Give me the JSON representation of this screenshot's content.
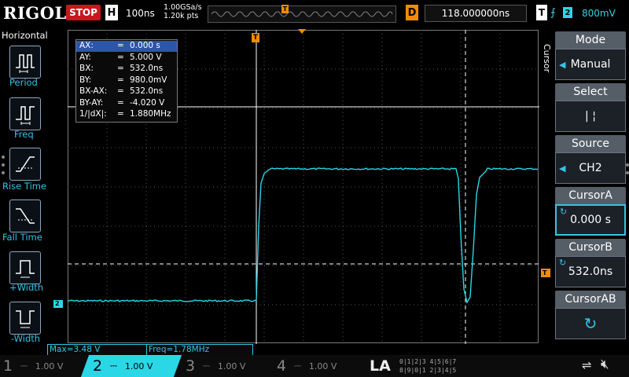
{
  "top": {
    "brand": "RIGOL",
    "run_state": "STOP",
    "horizontal_mode": "H",
    "timebase": "100ns",
    "sample_rate": "1.00GSa/s",
    "points": "1.20k pts",
    "delay_label": "D",
    "delay_value": "118.000000ns",
    "trigger_label": "T",
    "trigger_source": "2",
    "trigger_level": "800mV",
    "trigger_marker": "T"
  },
  "left_panel": {
    "title": "Horizontal",
    "items": [
      {
        "label": "Period",
        "icon": "period-icon"
      },
      {
        "label": "Freq",
        "icon": "freq-icon"
      },
      {
        "label": "Rise Time",
        "icon": "rise-time-icon"
      },
      {
        "label": "Fall Time",
        "icon": "fall-time-icon"
      },
      {
        "label": "+Width",
        "icon": "positive-width-icon"
      },
      {
        "label": "-Width",
        "icon": "negative-width-icon"
      }
    ]
  },
  "cursor_info": {
    "rows": [
      {
        "k": "AX:",
        "v": "0.000 s"
      },
      {
        "k": "AY:",
        "v": "5.000 V"
      },
      {
        "k": "BX:",
        "v": "532.0ns"
      },
      {
        "k": "BY:",
        "v": "980.0mV"
      },
      {
        "k": "BX-AX:",
        "v": "532.0ns"
      },
      {
        "k": "BY-AY:",
        "v": "-4.020 V"
      },
      {
        "k": "1/|dX|:",
        "v": "1.880MHz"
      }
    ],
    "sep": "="
  },
  "right_panel": {
    "vertical_title": "Cursor",
    "mode_title": "Mode",
    "mode_value": "Manual",
    "select_title": "Select",
    "select_value": "|   ¦",
    "source_title": "Source",
    "source_value": "CH2",
    "cursor_a_title": "CursorA",
    "cursor_a_value": "0.000 s",
    "cursor_b_title": "CursorB",
    "cursor_b_value": "532.0ns",
    "cursor_ab_title": "CursorAB"
  },
  "measurements": {
    "max": "Max=3.48 V",
    "freq": "Freq=1.78MHz"
  },
  "channels": [
    {
      "num": "1",
      "scale": "1.00 V",
      "active": false
    },
    {
      "num": "2",
      "scale": "1.00 V",
      "active": true
    },
    {
      "num": "3",
      "scale": "1.00 V",
      "active": false
    },
    {
      "num": "4",
      "scale": "1.00 V",
      "active": false
    }
  ],
  "la": {
    "label": "LA",
    "row1": "0|1|2|3  4|5|6|7",
    "row2": "8|9|0|1  2|3|4|5"
  },
  "channel2_marker": "2",
  "colors": {
    "trace": "#2ad7e6",
    "accent": "#35c4e8",
    "stop": "#c8171d",
    "trigger": "#f28c00"
  }
}
